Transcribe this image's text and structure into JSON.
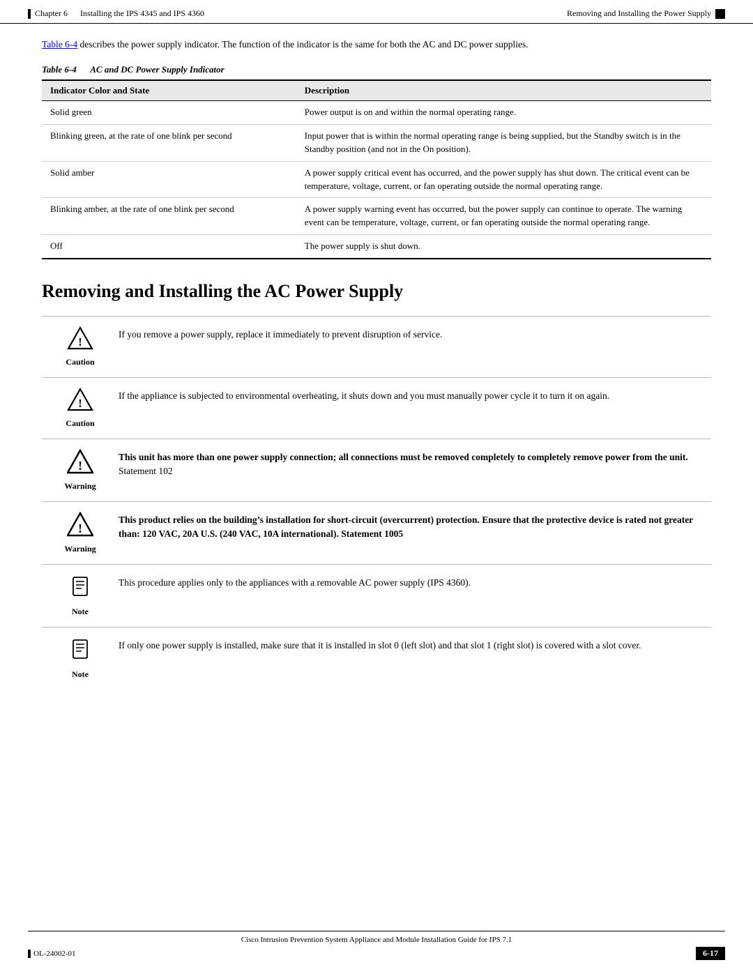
{
  "header": {
    "left_bar": true,
    "chapter": "Chapter 6",
    "chapter_title": "Installing the IPS 4345 and IPS 4360",
    "right_title": "Removing and Installing the Power Supply",
    "right_bar": true
  },
  "intro": {
    "text_before_link": "",
    "link_text": "Table 6-4",
    "text_after": " describes the power supply indicator. The function of the indicator is the same for both the AC and DC power supplies."
  },
  "table": {
    "caption_italic": "Table 6-4",
    "caption_text": "AC and DC Power Supply Indicator",
    "headers": [
      "Indicator Color and State",
      "Description"
    ],
    "rows": [
      {
        "indicator": "Solid green",
        "description": "Power output is on and within the normal operating range."
      },
      {
        "indicator": "Blinking green, at the rate of one blink per second",
        "description": "Input power that is within the normal operating range is being supplied, but the Standby switch is in the Standby position (and not in the On position)."
      },
      {
        "indicator": "Solid amber",
        "description": "A power supply critical event has occurred, and the power supply has shut down. The critical event can be temperature, voltage, current, or fan operating outside the normal operating range."
      },
      {
        "indicator": "Blinking amber, at the rate of one blink per second",
        "description": "A power supply warning event has occurred, but the power supply can continue to operate. The warning event can be temperature, voltage, current, or fan operating outside the normal operating range."
      },
      {
        "indicator": "Off",
        "description": "The power supply is shut down."
      }
    ]
  },
  "section_heading": "Removing and Installing the AC Power Supply",
  "notices": [
    {
      "type": "caution",
      "label": "Caution",
      "body_html": "If you remove a power supply, replace it immediately to prevent disruption of service."
    },
    {
      "type": "caution",
      "label": "Caution",
      "body_html": "If the appliance is subjected to environmental overheating, it shuts down and you must manually power cycle it to turn it on again."
    },
    {
      "type": "warning",
      "label": "Warning",
      "body_html": "<strong>This unit has more than one power supply connection; all connections must be removed completely to completely remove power from the unit.</strong> Statement 102"
    },
    {
      "type": "warning",
      "label": "Warning",
      "body_html": "<strong>This product relies on the building’s installation for short-circuit (overcurrent) protection. Ensure that the protective device is rated not greater than: 120 VAC, 20A U.S. (240 VAC, 10A international). Statement 1005</strong>"
    },
    {
      "type": "note",
      "label": "Note",
      "body_html": "This procedure applies only to the appliances with a removable AC power supply (IPS 4360)."
    },
    {
      "type": "note",
      "label": "Note",
      "body_html": "If only one power supply is installed, make sure that it is installed in slot 0 (left slot) and that slot 1 (right slot) is covered with a slot cover."
    }
  ],
  "footer": {
    "center_text": "Cisco Intrusion Prevention System Appliance and Module Installation Guide for IPS 7.1",
    "left_text": "OL-24002-01",
    "page_number": "6-17"
  }
}
